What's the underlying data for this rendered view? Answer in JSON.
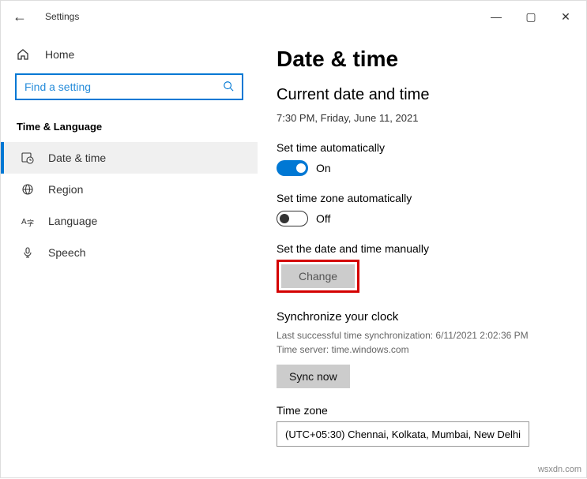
{
  "titlebar": {
    "app_title": "Settings"
  },
  "sidebar": {
    "home_label": "Home",
    "search_placeholder": "Find a setting",
    "category": "Time & Language",
    "items": [
      {
        "label": "Date & time"
      },
      {
        "label": "Region"
      },
      {
        "label": "Language"
      },
      {
        "label": "Speech"
      }
    ]
  },
  "main": {
    "page_title": "Date & time",
    "subtitle": "Current date and time",
    "current_datetime": "7:30 PM, Friday, June 11, 2021",
    "auto_time_label": "Set time automatically",
    "auto_time_state": "On",
    "auto_tz_label": "Set time zone automatically",
    "auto_tz_state": "Off",
    "manual_label": "Set the date and time manually",
    "change_btn": "Change",
    "sync_title": "Synchronize your clock",
    "sync_last": "Last successful time synchronization: 6/11/2021 2:02:36 PM",
    "sync_server": "Time server: time.windows.com",
    "sync_btn": "Sync now",
    "tz_label": "Time zone",
    "tz_value": "(UTC+05:30) Chennai, Kolkata, Mumbai, New Delhi"
  },
  "attribution": "wsxdn.com"
}
